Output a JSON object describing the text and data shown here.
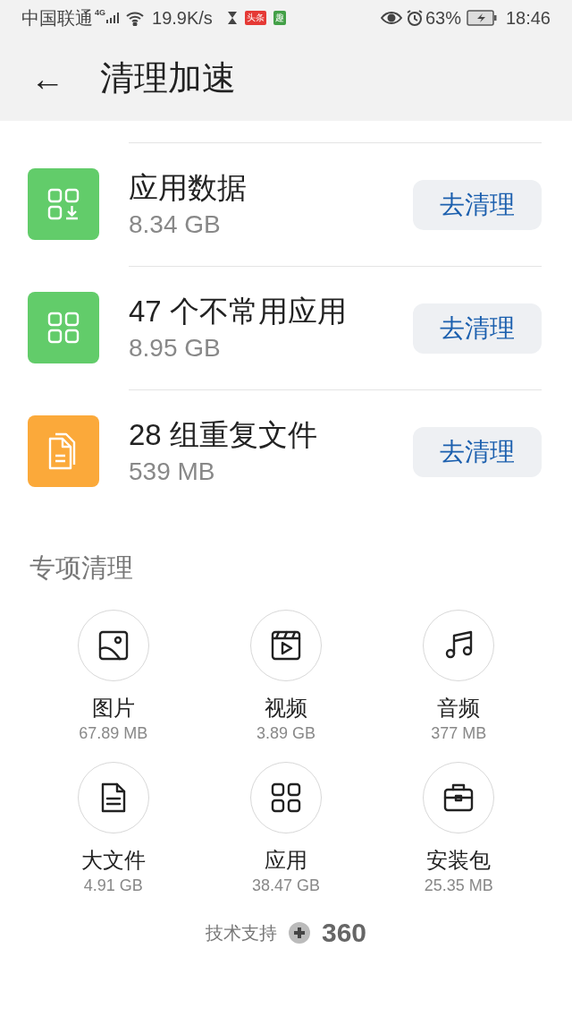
{
  "status_bar": {
    "carrier": "中国联通",
    "network": "4G",
    "speed": "19.9K/s",
    "app_badges": [
      {
        "label": "头条",
        "color": "#e53935"
      },
      {
        "label": "趣",
        "color": "#43a047"
      }
    ],
    "battery": "63%",
    "time": "18:46"
  },
  "header": {
    "back": "←",
    "title": "清理加速"
  },
  "clean_items": [
    {
      "kind": "app-data",
      "color": "#62cc6a",
      "title": "应用数据",
      "size": "8.34 GB",
      "button": "去清理"
    },
    {
      "kind": "apps",
      "color": "#62cc6a",
      "title": "47 个不常用应用",
      "size": "8.95 GB",
      "button": "去清理"
    },
    {
      "kind": "files",
      "color": "#fba93a",
      "title": "28 组重复文件",
      "size": "539 MB",
      "button": "去清理"
    }
  ],
  "special_section": {
    "title": "专项清理",
    "items": [
      {
        "kind": "image",
        "label": "图片",
        "size": "67.89 MB"
      },
      {
        "kind": "video",
        "label": "视频",
        "size": "3.89 GB"
      },
      {
        "kind": "audio",
        "label": "音频",
        "size": "377 MB"
      },
      {
        "kind": "document",
        "label": "大文件",
        "size": "4.91 GB"
      },
      {
        "kind": "apps",
        "label": "应用",
        "size": "38.47 GB"
      },
      {
        "kind": "package",
        "label": "安装包",
        "size": "25.35 MB"
      }
    ]
  },
  "footer": {
    "label": "技术支持",
    "brand": "360"
  }
}
